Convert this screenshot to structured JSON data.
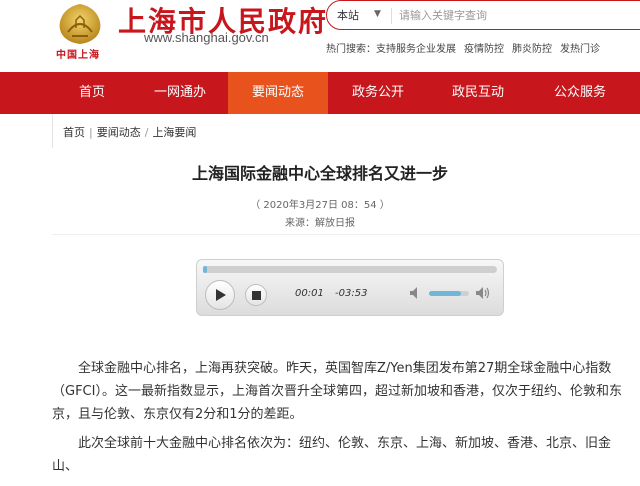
{
  "header": {
    "site_title": "上海市人民政府",
    "site_url": "www.shanghai.gov.cn",
    "emblem_caption": "中国上海",
    "search": {
      "scope_label": "本站",
      "placeholder": "请输入关键字查询"
    },
    "hot_search": {
      "label": "热门搜索：",
      "items": [
        "支持服务企业发展",
        "疫情防控",
        "肺炎防控",
        "发热门诊"
      ]
    }
  },
  "nav": {
    "items": [
      {
        "label": "首页"
      },
      {
        "label": "一网通办"
      },
      {
        "label": "要闻动态"
      },
      {
        "label": "政务公开"
      },
      {
        "label": "政民互动"
      },
      {
        "label": "公众服务"
      }
    ],
    "active_index": 2
  },
  "breadcrumb": [
    "首页",
    "要闻动态",
    "上海要闻"
  ],
  "article": {
    "title": "上海国际金融中心全球排名又进一步",
    "date": "（ 2020年3月27日 08：54 ）",
    "source": "来源：解放日报",
    "paragraphs": [
      "全球金融中心排名，上海再获突破。昨天，英国智库Z/Yen集团发布第27期全球金融中心指数（GFCI）。这一最新指数显示，上海首次晋升全球第四，超过新加坡和香港，仅次于纽约、伦敦和东京，且与伦敦、东京仅有2分和1分的差距。",
      "此次全球前十大金融中心排名依次为：纽约、伦敦、东京、上海、新加坡、香港、北京、旧金山、"
    ]
  },
  "player": {
    "current_time": "00:01",
    "remaining_time": "-03:53",
    "progress_fraction": 0.01,
    "volume_fraction": 0.8
  },
  "colors": {
    "brand_red": "#c8161d",
    "nav_active": "#e8531d",
    "player_accent": "#6fb6d9"
  }
}
